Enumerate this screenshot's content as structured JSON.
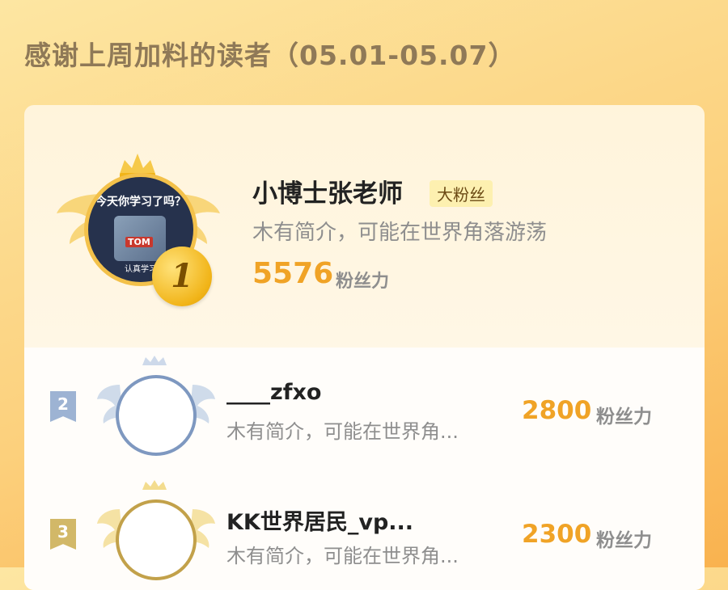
{
  "header": {
    "title": "感谢上周加料的读者（05.01-05.07）"
  },
  "first": {
    "rank": "1",
    "name": "小博士张老师",
    "badge": "大粉丝",
    "intro": "木有简介，可能在世界角落游荡",
    "score": "5576",
    "score_unit": "粉丝力",
    "avatar_caption": "今天你学习了吗？",
    "avatar_brand": "TOM",
    "avatar_footer": "认真学习"
  },
  "rows": [
    {
      "rank": "2",
      "name": "____zfxo",
      "intro": "木有简介，可能在世界角...",
      "score": "2800",
      "score_unit": "粉丝力",
      "color": "#8ea6c9"
    },
    {
      "rank": "3",
      "name": "KK世界居民_vp...",
      "intro": "木有简介，可能在世界角...",
      "score": "2300",
      "score_unit": "粉丝力",
      "color": "#c9a94d"
    }
  ],
  "colors": {
    "gold": "#f0a326",
    "silver": "#8ea6c9",
    "bronze": "#c9a94d"
  }
}
